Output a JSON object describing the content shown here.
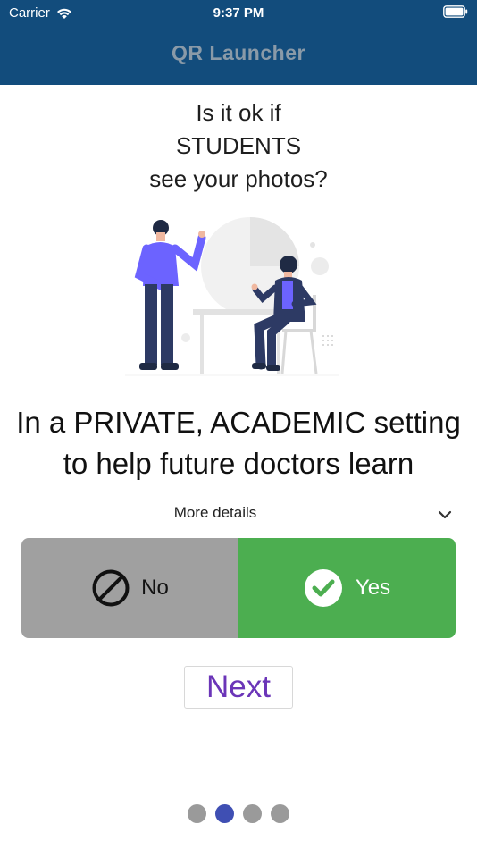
{
  "status_bar": {
    "carrier": "Carrier",
    "time": "9:37 PM"
  },
  "header": {
    "title": "QR Launcher"
  },
  "question": {
    "line1": "Is it ok if",
    "line2": "STUDENTS",
    "line3": "see your photos?"
  },
  "statement": {
    "line1": "In a PRIVATE, ACADEMIC setting",
    "line2": "to help future doctors learn"
  },
  "details": {
    "label": "More details"
  },
  "consent_toggle": {
    "no_label": "No",
    "yes_label": "Yes",
    "selected": "Yes",
    "colors": {
      "no_bg": "#a0a0a0",
      "yes_bg": "#4cae50"
    }
  },
  "next_button": {
    "label": "Next",
    "color": "#6b35b8"
  },
  "pager": {
    "total": 4,
    "current": 2,
    "active_color": "#3f4fb3"
  },
  "colors": {
    "header_bg": "#124c7c"
  }
}
